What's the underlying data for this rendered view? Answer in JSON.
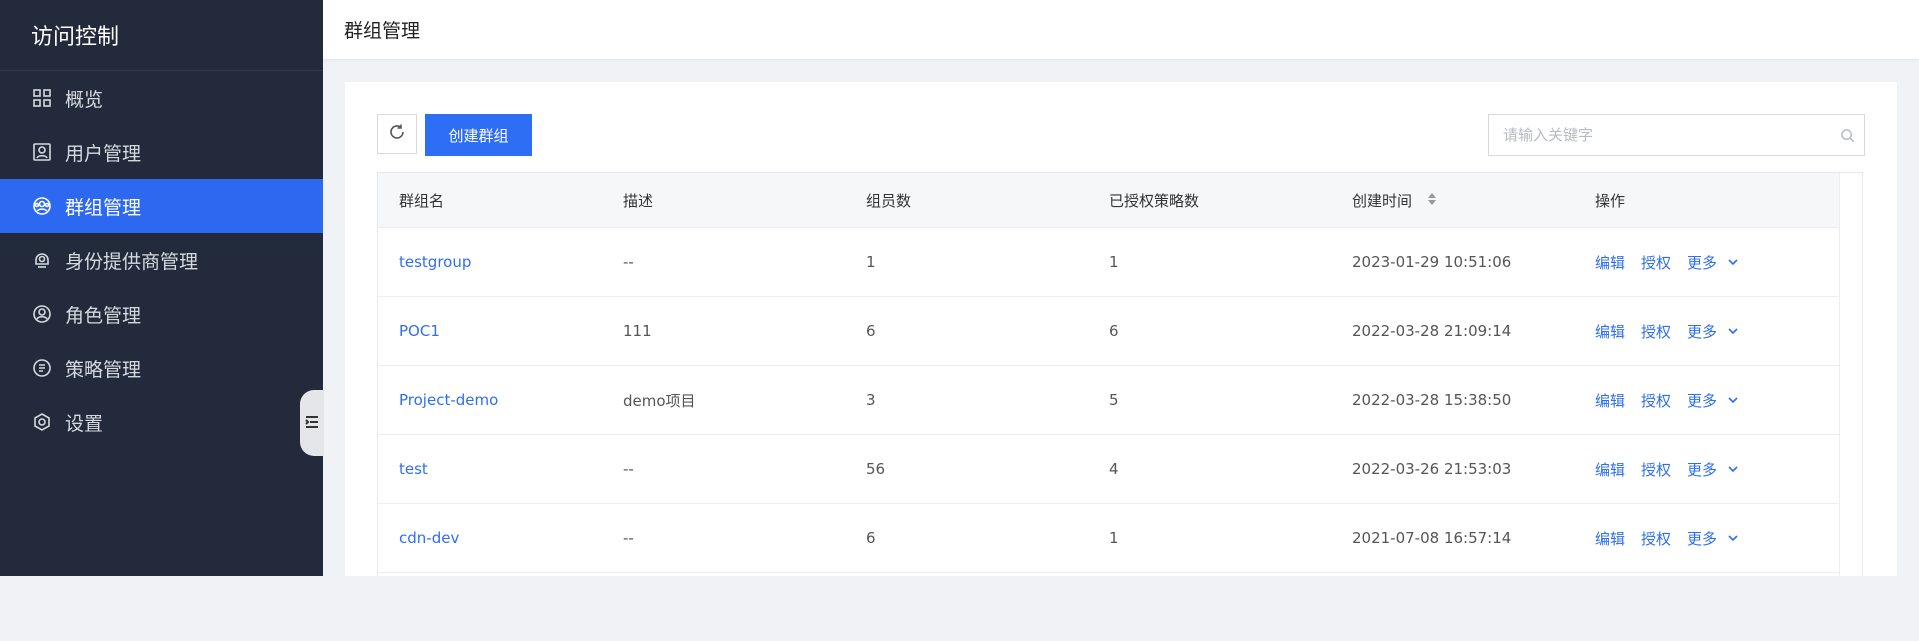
{
  "sidebar": {
    "title": "访问控制",
    "items": [
      {
        "label": "概览",
        "icon": "grid-icon",
        "active": false
      },
      {
        "label": "用户管理",
        "icon": "user-card-icon",
        "active": false
      },
      {
        "label": "群组管理",
        "icon": "group-icon",
        "active": true
      },
      {
        "label": "身份提供商管理",
        "icon": "identity-provider-icon",
        "active": false
      },
      {
        "label": "角色管理",
        "icon": "role-icon",
        "active": false
      },
      {
        "label": "策略管理",
        "icon": "policy-icon",
        "active": false
      },
      {
        "label": "设置",
        "icon": "settings-icon",
        "active": false
      }
    ]
  },
  "header": {
    "title": "群组管理"
  },
  "toolbar": {
    "create_label": "创建群组",
    "search_placeholder": "请输入关键字"
  },
  "table": {
    "columns": [
      "群组名",
      "描述",
      "组员数",
      "已授权策略数",
      "创建时间",
      "操作"
    ],
    "rows": [
      {
        "name": "testgroup",
        "desc": "--",
        "members": "1",
        "policies": "1",
        "created": "2023-01-29 10:51:06"
      },
      {
        "name": "POC1",
        "desc": "111",
        "members": "6",
        "policies": "6",
        "created": "2022-03-28 21:09:14"
      },
      {
        "name": "Project-demo",
        "desc": "demo项目",
        "members": "3",
        "policies": "5",
        "created": "2022-03-28 15:38:50"
      },
      {
        "name": "test",
        "desc": "--",
        "members": "56",
        "policies": "4",
        "created": "2022-03-26 21:53:03"
      },
      {
        "name": "cdn-dev",
        "desc": "--",
        "members": "6",
        "policies": "1",
        "created": "2021-07-08 16:57:14"
      }
    ],
    "actions": {
      "edit": "编辑",
      "grant": "授权",
      "more": "更多"
    }
  },
  "colors": {
    "accent": "#2e6ef5",
    "sidebar_bg": "#232a3b",
    "active_bg": "#2d68f0"
  }
}
